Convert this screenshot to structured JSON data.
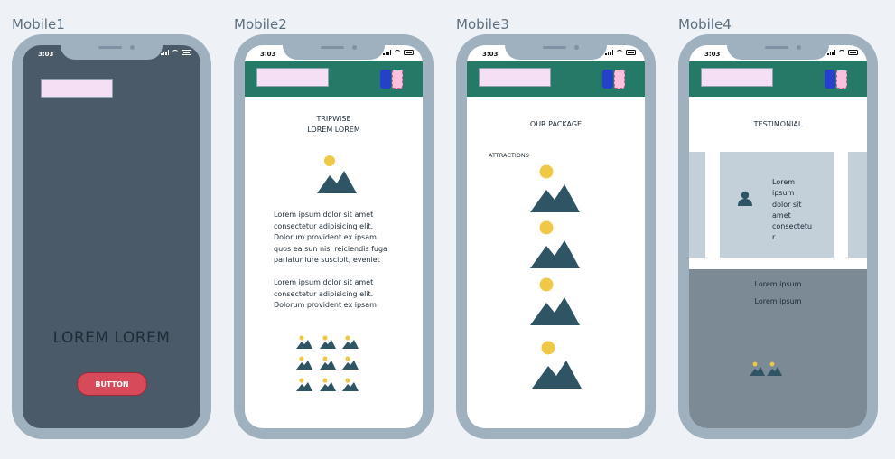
{
  "screens": [
    {
      "label": "Mobile1",
      "time": "3:03",
      "headline": "LOREM LOREM",
      "button_label": "BUTTON"
    },
    {
      "label": "Mobile2",
      "time": "3:03",
      "title_line1": "TRIPWISE",
      "title_line2": "LOREM LOREM",
      "paragraph1": [
        "Lorem ipsum dolor sit amet",
        "consectetur adipisicing elit.",
        "Dolorum provident ex ipsam",
        "quos ea sun nisi reiciendis fuga",
        "pariatur iure suscipit, eveniet"
      ],
      "paragraph2": [
        "Lorem ipsum dolor sit amet",
        "consectetur adipisicing elit.",
        "Dolorum provident ex ipsam"
      ]
    },
    {
      "label": "Mobile3",
      "time": "3:03",
      "title": "OUR PACKAGE",
      "section_label": "ATTRACTIONS"
    },
    {
      "label": "Mobile4",
      "time": "3:03",
      "title": "TESTIMONIAL",
      "card_text": [
        "Lorem",
        "ipsum",
        "dolor sit",
        "amet",
        "consectetu",
        "r"
      ],
      "footer_line1": "Lorem ipsum",
      "footer_line2": "Lorem ipsum"
    }
  ],
  "colors": {
    "phone_frame": "#9fb0be",
    "header_green": "#247a66",
    "button_red": "#d74a5a",
    "dark_screen": "#4a5a68",
    "sun_yellow": "#f0c848",
    "mountain": "#2f5565"
  },
  "icons": [
    "image-placeholder-icon",
    "user-icon",
    "signal-icon",
    "wifi-icon",
    "battery-icon"
  ]
}
